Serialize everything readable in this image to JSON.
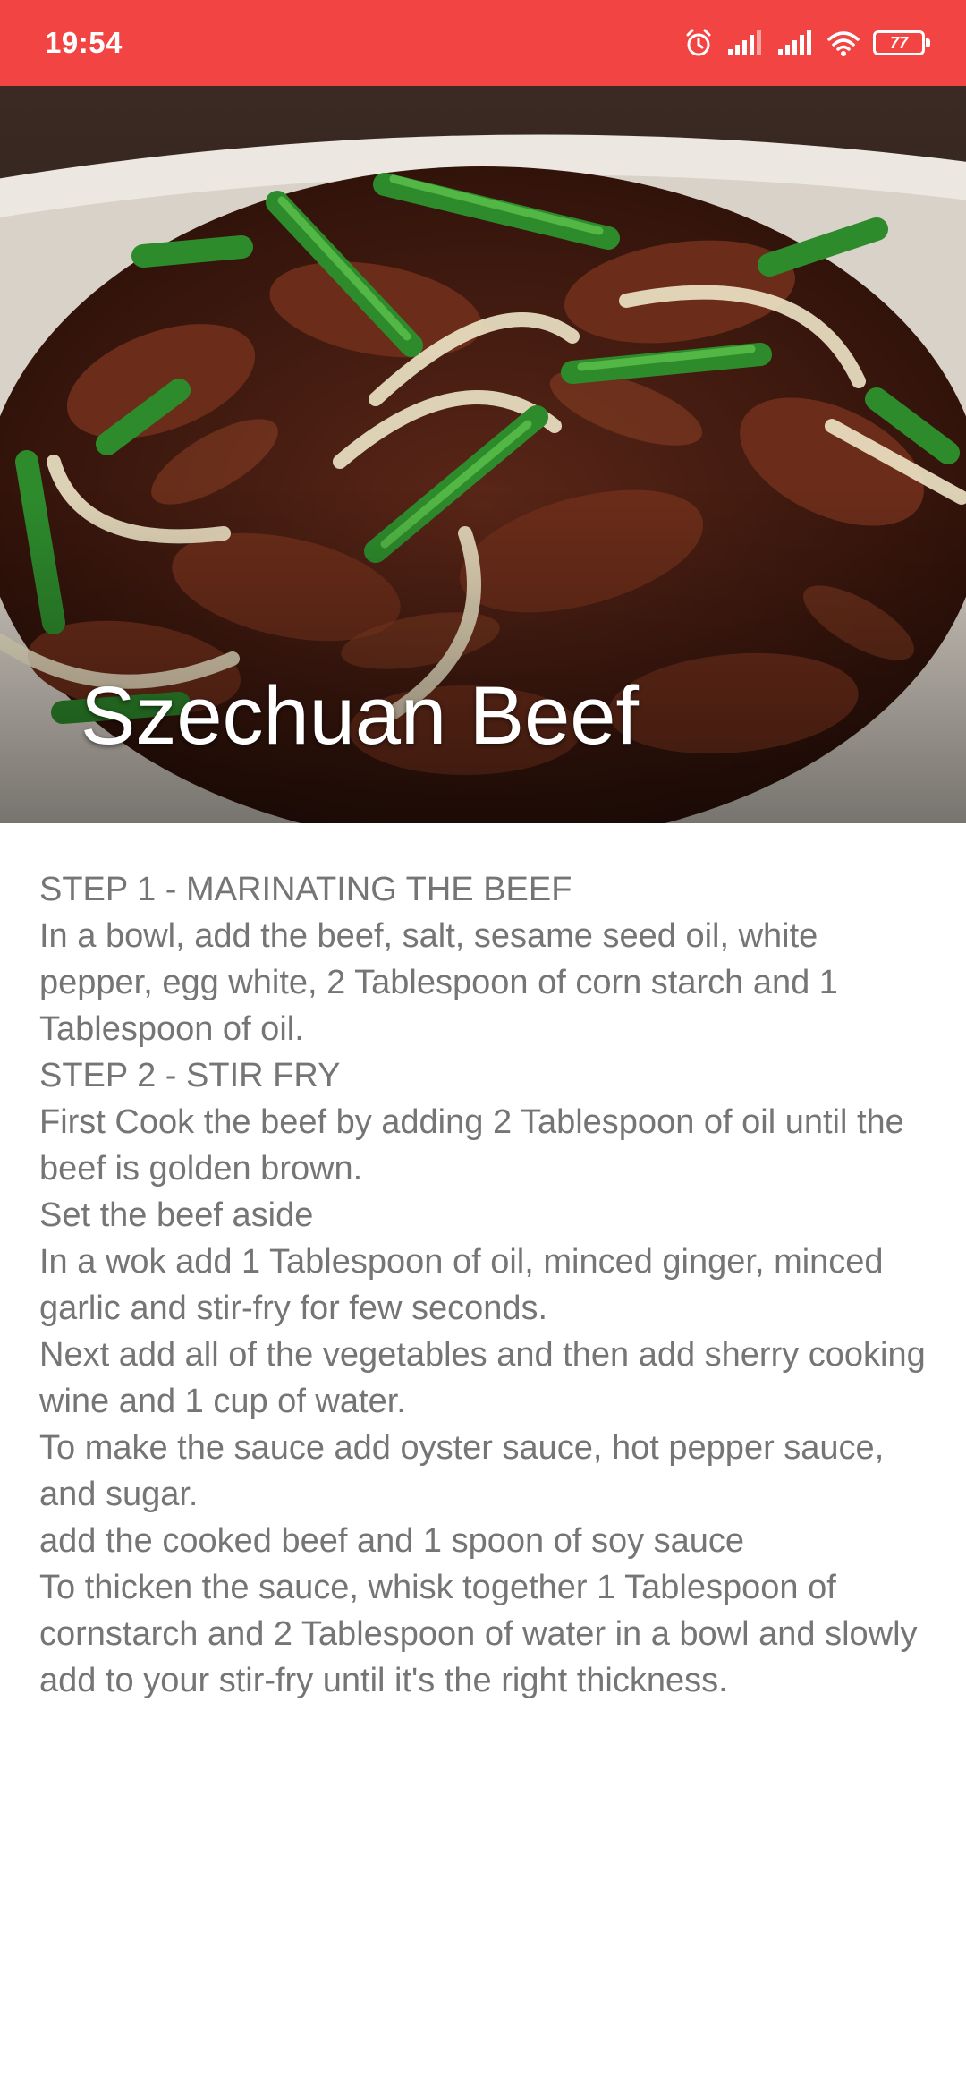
{
  "status_bar": {
    "time": "19:54",
    "battery_level": "77",
    "icons": [
      "alarm-icon",
      "signal-icon",
      "signal-icon",
      "wifi-icon",
      "battery-icon"
    ],
    "background_color": "#f34444"
  },
  "hero": {
    "title": "Szechuan Beef",
    "image_description_icon": "dish-photo"
  },
  "recipe": {
    "lines": [
      "STEP 1 - MARINATING THE BEEF",
      "In a bowl, add the beef, salt, sesame seed oil, white pepper, egg white, 2 Tablespoon of corn starch and 1 Tablespoon of oil.",
      "STEP 2 - STIR FRY",
      "First Cook the beef by adding 2 Tablespoon of oil until the beef is golden brown.",
      "Set the beef aside",
      "In a wok add 1 Tablespoon of oil, minced ginger, minced garlic and stir-fry for few seconds.",
      "Next add all of the vegetables and then add sherry cooking wine and 1 cup of water.",
      "To make the sauce add oyster sauce, hot pepper sauce, and sugar.",
      "add the cooked beef and 1 spoon of soy sauce",
      "To thicken the sauce, whisk together 1 Tablespoon of cornstarch and 2 Tablespoon of water in a bowl and slowly add to your stir-fry until it's the right thickness."
    ]
  }
}
